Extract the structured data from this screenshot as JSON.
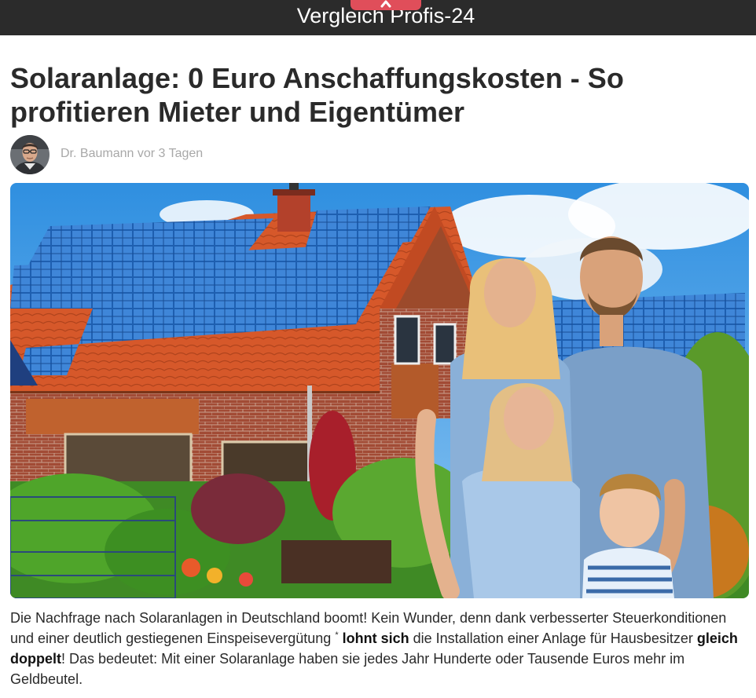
{
  "header": {
    "brand": "Vergleich Profis-24",
    "badge_icon": "chevron-up-icon",
    "bar_color": "#2b2b2b",
    "badge_color": "#e04e5a"
  },
  "article": {
    "title": "Solaranlage: 0 Euro Anschaffungskosten - So profitieren Mieter und Eigentümer",
    "author": "Dr. Baumann",
    "time": "vor 3 Tagen",
    "hero_alt": "Familie vor Haus mit Solaranlage auf dem Dach",
    "body": {
      "p1": "Die Nachfrage nach Solaranlagen in Deutschland boomt! Kein Wunder, denn dank verbesserter Steuerkonditionen und einer deutlich gestiegenen Einspeisevergütung",
      "footnote": "*",
      "bold1": "lohnt sich",
      "p2": "die Installation einer Anlage für Hausbesitzer",
      "bold2": "gleich doppelt",
      "p3": "! Das bedeutet: Mit einer Solaranlage haben sie jedes Jahr Hunderte oder Tausende Euros mehr im Geldbeutel."
    }
  }
}
